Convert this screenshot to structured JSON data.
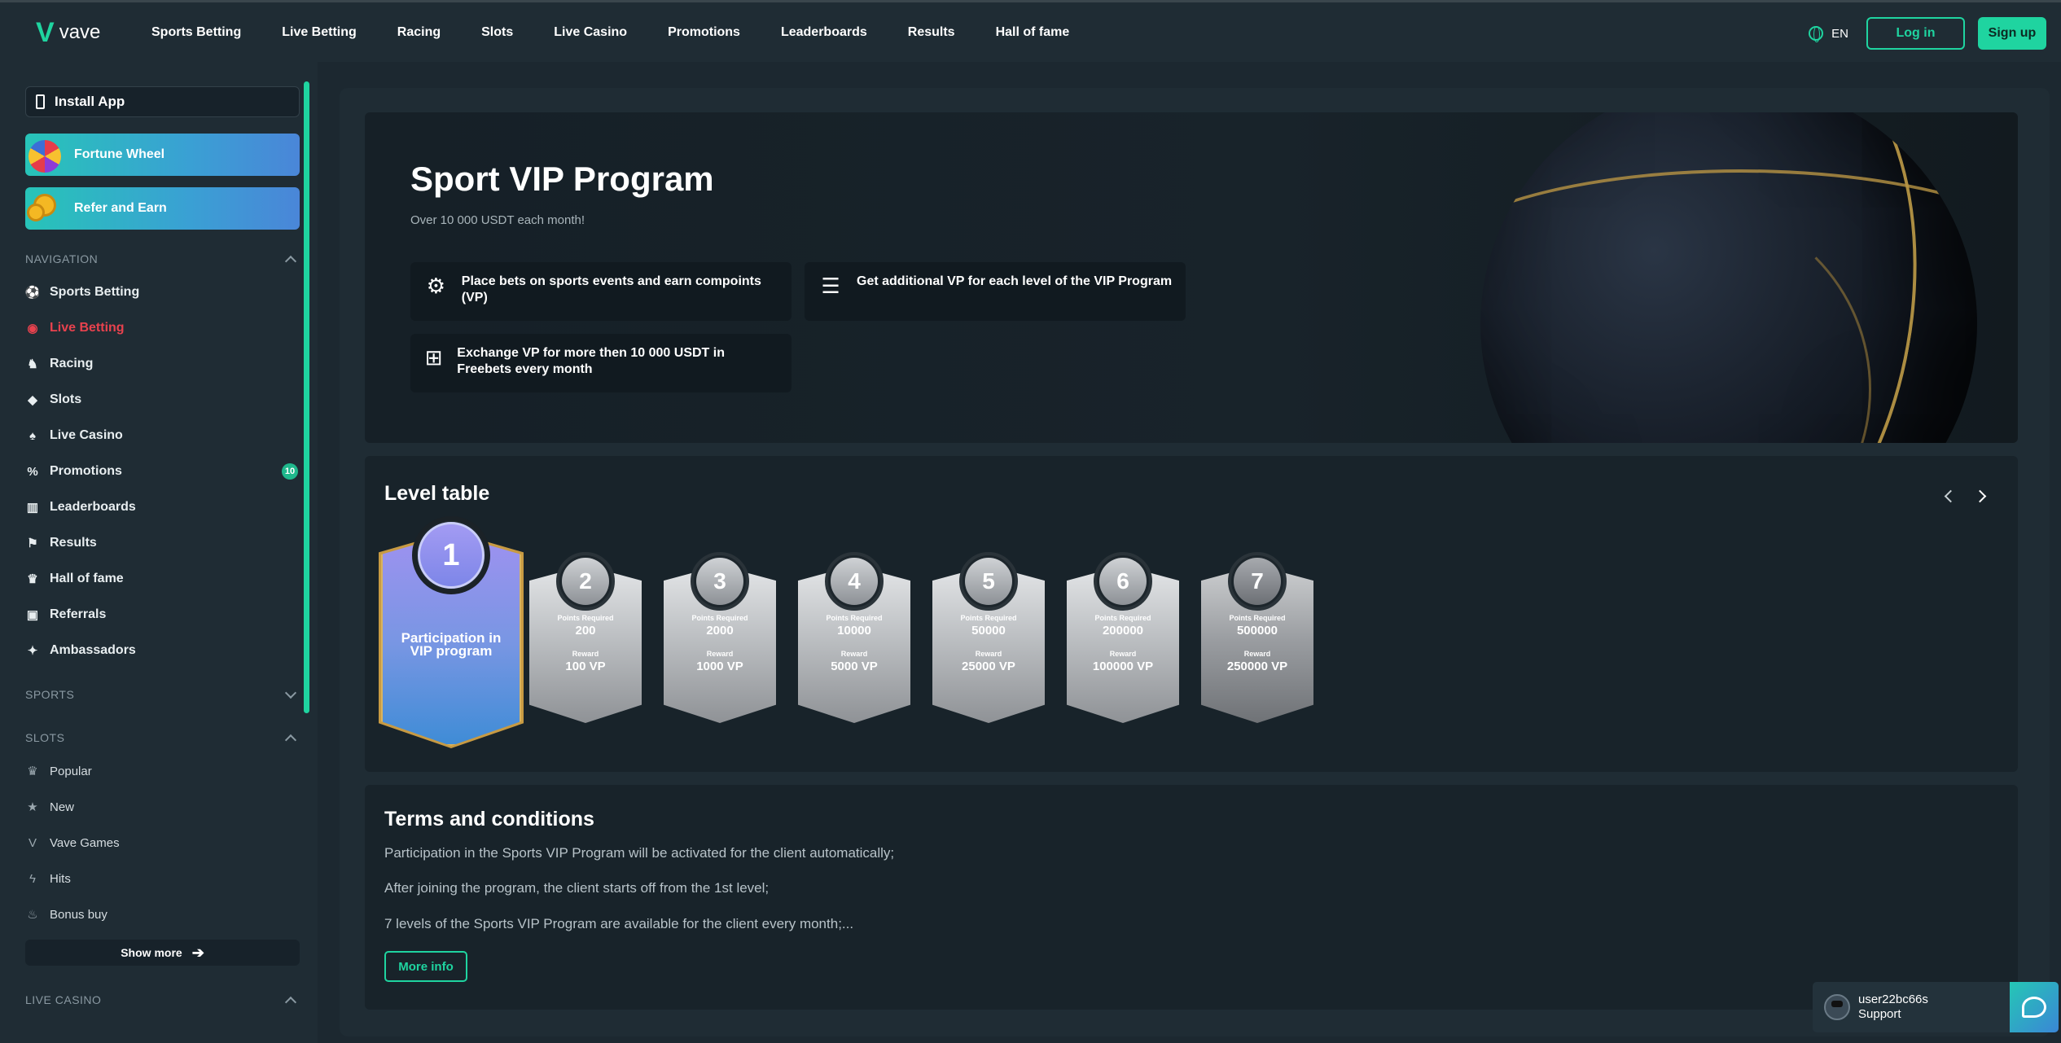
{
  "header": {
    "logo_text": "vave",
    "nav": [
      "Sports Betting",
      "Live Betting",
      "Racing",
      "Slots",
      "Live Casino",
      "Promotions",
      "Leaderboards",
      "Results",
      "Hall of fame"
    ],
    "lang": "EN",
    "login_label": "Log in",
    "signup_label": "Sign up"
  },
  "sidebar": {
    "install_label": "Install App",
    "fortune_label": "Fortune Wheel",
    "refer_label": "Refer and Earn",
    "navigation_title": "NAVIGATION",
    "nav_items": [
      {
        "label": "Sports Betting",
        "icon": "ball-icon"
      },
      {
        "label": "Live Betting",
        "icon": "live-icon"
      },
      {
        "label": "Racing",
        "icon": "horse-icon"
      },
      {
        "label": "Slots",
        "icon": "slots-icon"
      },
      {
        "label": "Live Casino",
        "icon": "casino-icon"
      },
      {
        "label": "Promotions",
        "icon": "promo-icon",
        "badge": "10"
      },
      {
        "label": "Leaderboards",
        "icon": "leaderboard-icon"
      },
      {
        "label": "Results",
        "icon": "flag-icon"
      },
      {
        "label": "Hall of fame",
        "icon": "trophy-icon"
      },
      {
        "label": "Referrals",
        "icon": "referrals-icon"
      },
      {
        "label": "Ambassadors",
        "icon": "ambassadors-icon"
      }
    ],
    "sports_title": "SPORTS",
    "slots_title": "SLOTS",
    "slot_items": [
      {
        "label": "Popular",
        "icon": "crown-icon"
      },
      {
        "label": "New",
        "icon": "star-icon"
      },
      {
        "label": "Vave Games",
        "icon": "vave-icon"
      },
      {
        "label": "Hits",
        "icon": "lightning-icon"
      },
      {
        "label": "Bonus buy",
        "icon": "bag-icon"
      }
    ],
    "show_more_label": "Show more",
    "live_casino_title": "LIVE CASINO"
  },
  "hero": {
    "title": "Sport VIP Program",
    "subtitle": "Over 10 000 USDT each month!",
    "features": [
      "Place bets on sports events and earn compoints (VP)",
      "Get additional VP for each level of the VIP Program",
      "Exchange VP for more then 10 000 USDT in Freebets every month"
    ]
  },
  "levels": {
    "title": "Level table",
    "points_label": "Points Required",
    "reward_label": "Reward",
    "first": {
      "number": "1",
      "text": "Participation in VIP program"
    },
    "items": [
      {
        "number": "2",
        "points": "200",
        "reward": "100 VP"
      },
      {
        "number": "3",
        "points": "2000",
        "reward": "1000 VP"
      },
      {
        "number": "4",
        "points": "10000",
        "reward": "5000 VP"
      },
      {
        "number": "5",
        "points": "50000",
        "reward": "25000 VP"
      },
      {
        "number": "6",
        "points": "200000",
        "reward": "100000 VP"
      },
      {
        "number": "7",
        "points": "500000",
        "reward": "250000 VP"
      }
    ]
  },
  "terms": {
    "title": "Terms and conditions",
    "lines": [
      "Participation in the Sports VIP Program will be activated for the client automatically;",
      "After joining the program, the client starts off from the 1st level;",
      "7 levels of the Sports VIP Program are available for the client every month;..."
    ],
    "more_label": "More info"
  },
  "support": {
    "user": "user22bc66s",
    "label": "Support"
  },
  "colors": {
    "accent": "#1fd4a0",
    "live": "#e8424e",
    "background": "#1c2830"
  }
}
